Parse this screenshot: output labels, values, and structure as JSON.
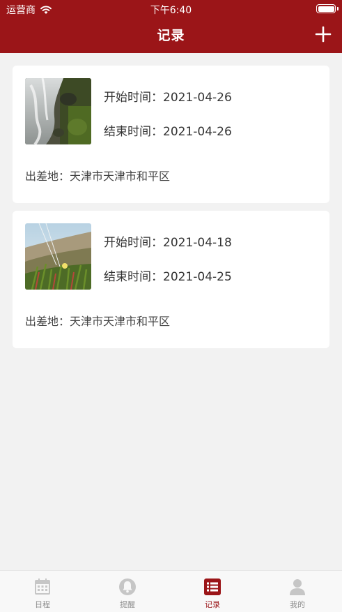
{
  "status_bar": {
    "carrier": "运营商",
    "time": "下午6:40"
  },
  "nav": {
    "title": "记录",
    "add_icon": "plus-icon"
  },
  "records": [
    {
      "start_text": "开始时间：2021-04-26",
      "end_text": "结束时间：2021-04-26",
      "place_text": "出差地：天津市天津市和平区",
      "thumbnail": "waterfall-rocks-photo"
    },
    {
      "start_text": "开始时间：2021-04-18",
      "end_text": "结束时间：2021-04-25",
      "place_text": "出差地：天津市天津市和平区",
      "thumbnail": "hillside-flower-photo"
    }
  ],
  "tabs": [
    {
      "label": "日程",
      "icon": "calendar-icon"
    },
    {
      "label": "提醒",
      "icon": "bell-icon"
    },
    {
      "label": "记录",
      "icon": "list-icon",
      "active": true
    },
    {
      "label": "我的",
      "icon": "user-icon"
    }
  ],
  "colors": {
    "primary": "#9b1518",
    "background": "#f2f2f2",
    "card": "#ffffff",
    "tab_inactive": "#c6c6c6"
  }
}
